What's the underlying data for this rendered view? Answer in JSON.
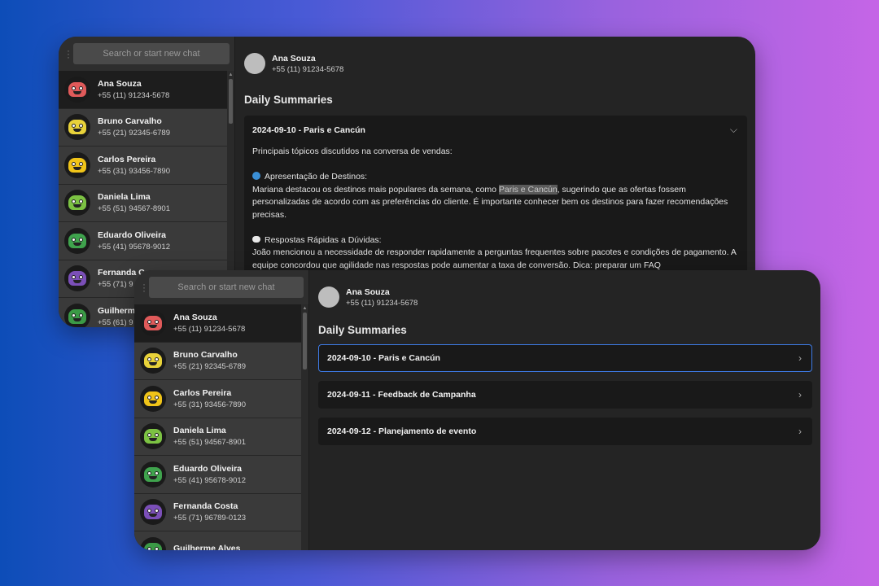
{
  "search_placeholder": "Search or start new chat",
  "header": {
    "name": "Ana Souza",
    "phone": "+55 (11) 91234-5678"
  },
  "section_title": "Daily Summaries",
  "contacts": [
    {
      "name": "Ana Souza",
      "phone": "+55 (11) 91234-5678",
      "color": "#e05a5a"
    },
    {
      "name": "Bruno Carvalho",
      "phone": "+55 (21) 92345-6789",
      "color": "#e8d23a"
    },
    {
      "name": "Carlos Pereira",
      "phone": "+55 (31) 93456-7890",
      "color": "#f0c419"
    },
    {
      "name": "Daniela Lima",
      "phone": "+55 (51) 94567-8901",
      "color": "#7cc243"
    },
    {
      "name": "Eduardo Oliveira",
      "phone": "+55 (41) 95678-9012",
      "color": "#3fa34d"
    },
    {
      "name": "Fernanda Costa",
      "phone": "+55 (71) 96789-0123",
      "color": "#7b4fb8"
    },
    {
      "name": "Guilherme Alves",
      "phone": "",
      "color": "#3b9a46"
    }
  ],
  "back_contacts": [
    {
      "name": "Ana Souza",
      "phone": "+55 (11) 91234-5678"
    },
    {
      "name": "Bruno Carvalho",
      "phone": "+55 (21) 92345-6789"
    },
    {
      "name": "Carlos Pereira",
      "phone": "+55 (31) 93456-7890"
    },
    {
      "name": "Daniela Lima",
      "phone": "+55 (51) 94567-8901"
    },
    {
      "name": "Eduardo Oliveira",
      "phone": "+55 (41) 95678-9012"
    },
    {
      "name": "Fernanda C",
      "phone": "+55 (71) 9"
    },
    {
      "name": "Guilherme",
      "phone": "+55 (61) 9"
    }
  ],
  "expanded_summary": {
    "title": "2024-09-10 - Paris e Cancún",
    "intro": "Principais tópicos discutidos na conversa de vendas:",
    "section1_title": "Apresentação de Destinos:",
    "section1_before": "Mariana destacou os destinos mais populares da semana, como ",
    "section1_highlight": "Paris e Cancún",
    "section1_after": ", sugerindo que as ofertas fossem personalizadas de acordo com as preferências do cliente. É importante conhecer bem os destinos para fazer recomendações precisas.",
    "section2_title": "Respostas Rápidas a Dúvidas:",
    "section2_text": "João mencionou a necessidade de responder rapidamente a perguntas frequentes sobre pacotes e condições de pagamento. A equipe concordou que agilidade nas respostas pode aumentar a taxa de conversão. Dica: preparar um FAQ"
  },
  "summaries": [
    {
      "title": "2024-09-10 - Paris e Cancún"
    },
    {
      "title": "2024-09-11 - Feedback de Campanha"
    },
    {
      "title": "2024-09-12 - Planejamento de evento"
    }
  ]
}
